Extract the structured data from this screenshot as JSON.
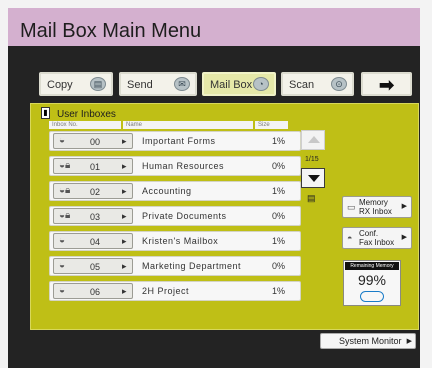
{
  "header": {
    "title": "Mail Box Main Menu"
  },
  "tabs": [
    {
      "label": "Copy",
      "icon": "copier-icon"
    },
    {
      "label": "Send",
      "icon": "send-icon"
    },
    {
      "label": "Mail Box",
      "icon": "mailbox-icon",
      "active": true
    },
    {
      "label": "Scan",
      "icon": "scanner-icon"
    },
    {
      "label": "➡",
      "icon": "arrow-right-icon"
    }
  ],
  "panel": {
    "title": "User Inboxes",
    "columns": {
      "inbox_no": "Inbox No.",
      "name": "Name",
      "size": "Size"
    },
    "rows": [
      {
        "no": "00",
        "name": "Important Forms",
        "size": "1%"
      },
      {
        "no": "01",
        "name": "Human Resources",
        "size": "0%"
      },
      {
        "no": "02",
        "name": "Accounting",
        "size": "1%"
      },
      {
        "no": "03",
        "name": "Private Documents",
        "size": "0%"
      },
      {
        "no": "04",
        "name": "Kristen's Mailbox",
        "size": "1%"
      },
      {
        "no": "05",
        "name": "Marketing Department",
        "size": "0%"
      },
      {
        "no": "06",
        "name": "2H Project",
        "size": "1%"
      }
    ],
    "page": "1/15"
  },
  "side": {
    "memory_rx": {
      "line1": "Memory",
      "line2": "RX Inbox"
    },
    "conf_fax": {
      "line1": "Conf.",
      "line2": "Fax Inbox"
    },
    "remaining_memory": {
      "label": "Remaining Memory",
      "value": "99%"
    }
  },
  "footer": {
    "system_monitor": "System Monitor"
  },
  "colors": {
    "header_bg": "#d4b0cf",
    "panel_bg": "#bfbf16",
    "screen_bg": "#232323"
  }
}
